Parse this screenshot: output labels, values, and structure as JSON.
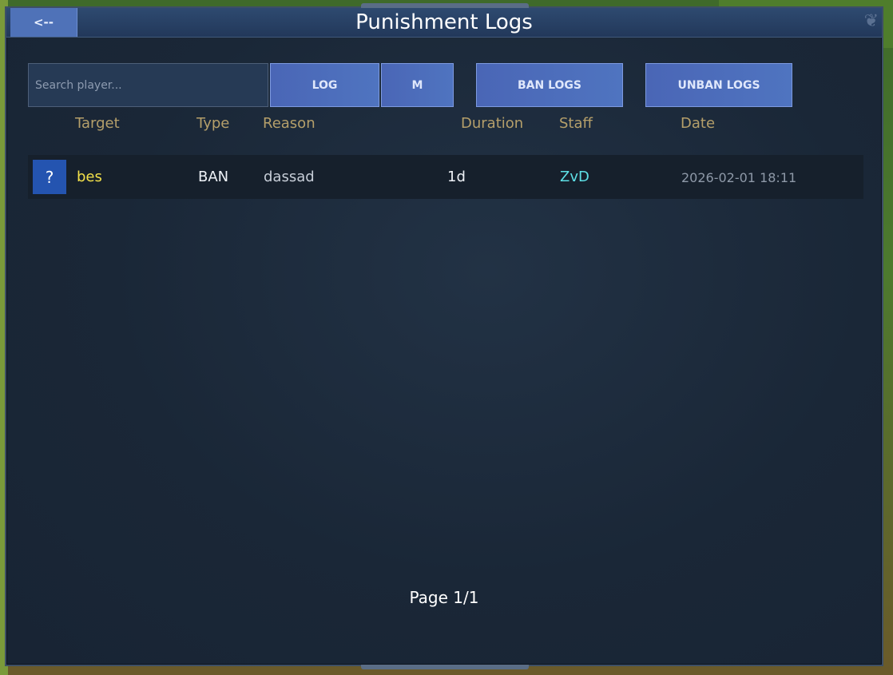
{
  "window": {
    "title": "Punishment Logs",
    "back_label": "<--"
  },
  "search": {
    "placeholder": "Search player..."
  },
  "buttons": {
    "log": "LOG",
    "m": "M",
    "ban_logs": "BAN LOGS",
    "unban_logs": "UNBAN LOGS"
  },
  "table": {
    "headers": [
      "Target",
      "Type",
      "Reason",
      "Duration",
      "Staff",
      "Date"
    ],
    "rows": [
      {
        "avatar": "?",
        "target": "bes",
        "type": "BAN",
        "reason": "dassad",
        "duration": "1d",
        "staff": "ZvD",
        "date": "2026-02-01 18:11"
      }
    ]
  },
  "pagination": {
    "label": "Page 1/1"
  },
  "colors": {
    "target": "#f3e14a",
    "staff": "#5ee0e6",
    "header": "#b59f6a",
    "button": "#4f74c0",
    "avatar": "#2454b0"
  }
}
